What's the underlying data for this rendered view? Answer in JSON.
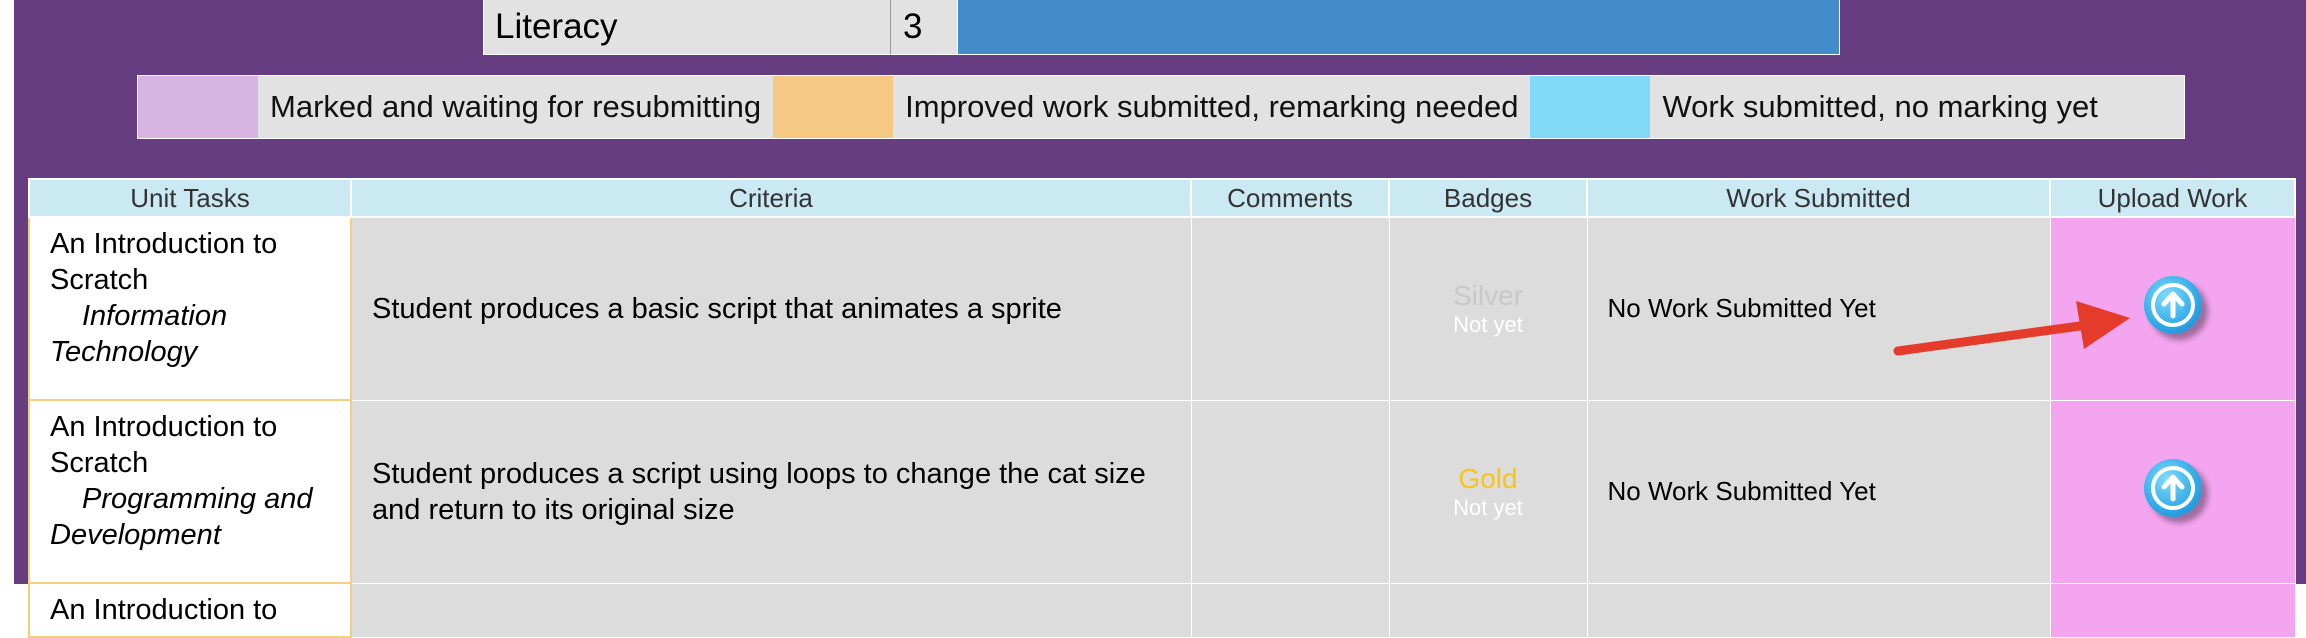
{
  "colors": {
    "background": "#673d82",
    "marked_waiting": "#d7b4e2",
    "improved_submitted": "#f5c983",
    "submitted_no_marking": "#82d9f7",
    "upload_cell": "#f4a5f0",
    "silver": "#c8c8c8",
    "gold": "#f5c518",
    "progress_bar": "#428ccb",
    "arrow": "#e53b2b"
  },
  "summary": {
    "label": "Literacy",
    "value": "3"
  },
  "legend": [
    {
      "label": "Marked and waiting for resubmitting",
      "color": "#d7b4e2"
    },
    {
      "label": "Improved work submitted, remarking needed",
      "color": "#f5c983"
    },
    {
      "label": "Work submitted, no marking yet",
      "color": "#82d9f7"
    }
  ],
  "table": {
    "headers": [
      "Unit Tasks",
      "Criteria",
      "Comments",
      "Badges",
      "Work Submitted",
      "Upload Work"
    ],
    "rows": [
      {
        "task_title": "An Introduction to Scratch",
        "task_category": "Information Technology",
        "criteria": "Student produces a basic script that animates a sprite",
        "comments": "",
        "badge": "Silver",
        "badge_status": "Not yet",
        "badge_color": "#c8c8c8",
        "work_submitted": "No Work Submitted Yet",
        "upload_icon": "upload-arrow-icon"
      },
      {
        "task_title": "An Introduction to Scratch",
        "task_category": "Programming and Development",
        "criteria": "Student produces a script using loops to change the cat size and return to its original size",
        "comments": "",
        "badge": "Gold",
        "badge_status": "Not yet",
        "badge_color": "#f5c518",
        "work_submitted": "No Work Submitted Yet",
        "upload_icon": "upload-arrow-icon"
      },
      {
        "task_title": "An Introduction to"
      }
    ]
  }
}
